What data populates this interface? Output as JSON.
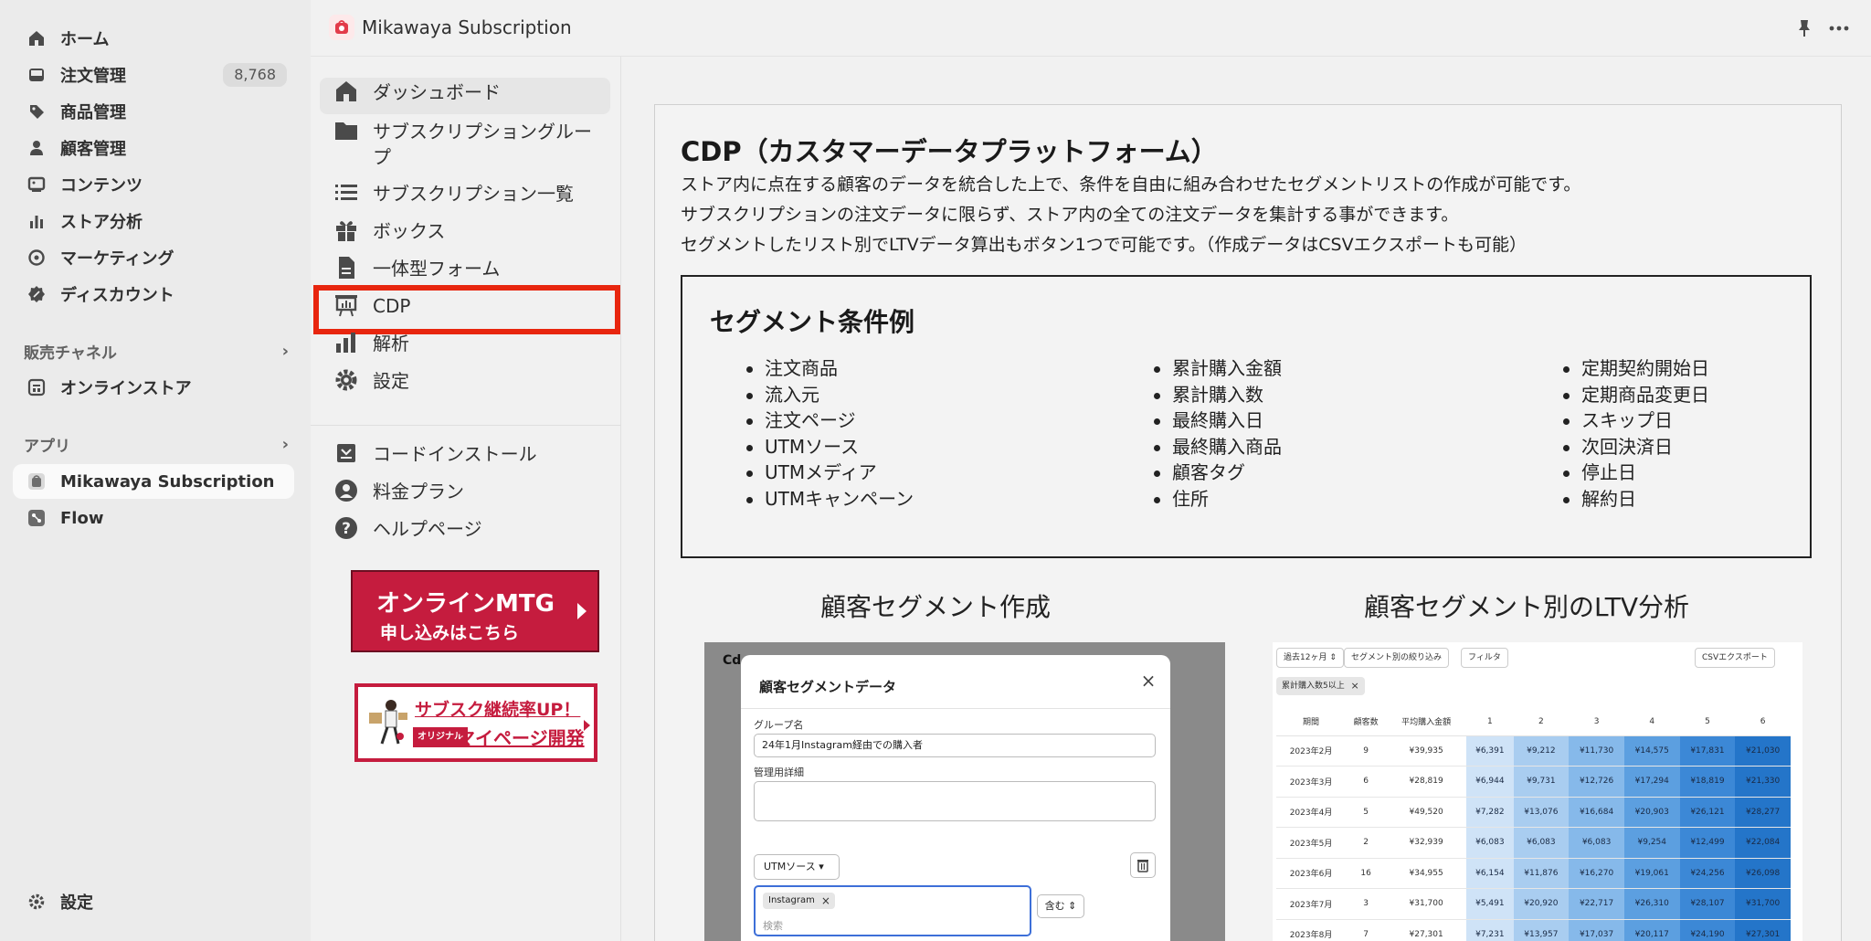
{
  "sidebar": {
    "items": [
      {
        "label": "ホーム",
        "icon": "home-icon"
      },
      {
        "label": "注文管理",
        "icon": "inbox-icon",
        "badge": "8,768"
      },
      {
        "label": "商品管理",
        "icon": "tag-icon"
      },
      {
        "label": "顧客管理",
        "icon": "person-icon"
      },
      {
        "label": "コンテンツ",
        "icon": "content-icon"
      },
      {
        "label": "ストア分析",
        "icon": "bar-chart-icon"
      },
      {
        "label": "マーケティング",
        "icon": "target-icon"
      },
      {
        "label": "ディスカウント",
        "icon": "discount-icon"
      }
    ],
    "sales_channel_header": "販売チャネル",
    "online_store": "オンラインストア",
    "apps_header": "アプリ",
    "app_mikawaya": "Mikawaya Subscription",
    "app_flow": "Flow",
    "settings": "設定"
  },
  "topbar": {
    "title": "Mikawaya Subscription"
  },
  "appnav": {
    "items": [
      {
        "label": "ダッシュボード"
      },
      {
        "label": "サブスクリプショングループ"
      },
      {
        "label": "サブスクリプション一覧"
      },
      {
        "label": "ボックス"
      },
      {
        "label": "一体型フォーム"
      },
      {
        "label": "CDP"
      },
      {
        "label": "解析"
      },
      {
        "label": "設定"
      }
    ],
    "secondary": [
      {
        "label": "コードインストール"
      },
      {
        "label": "料金プラン"
      },
      {
        "label": "ヘルプページ"
      }
    ],
    "mtg_banner": {
      "line1": "オンラインMTG",
      "line2": "申し込みはこちら"
    },
    "mypage_banner": {
      "line1": "サブスク継続率UP！",
      "tag": "オリジナル",
      "line2": "マイページ開発"
    }
  },
  "main": {
    "title": "CDP（カスタマーデータプラットフォーム）",
    "descriptions": [
      "ストア内に点在する顧客のデータを統合した上で、条件を自由に組み合わせたセグメントリストの作成が可能です。",
      "サブスクリプションの注文データに限らず、ストア内の全ての注文データを集計する事ができます。",
      "セグメントしたリスト別でLTVデータ算出もボタン1つで可能です。（作成データはCSVエクスポートも可能）"
    ],
    "segment_box": {
      "title": "セグメント条件例",
      "col1": [
        "注文商品",
        "流入元",
        "注文ページ",
        "UTMソース",
        "UTMメディア",
        "UTMキャンペーン"
      ],
      "col2": [
        "累計購入金額",
        "累計購入数",
        "最終購入日",
        "最終購入商品",
        "顧客タグ",
        "住所"
      ],
      "col3": [
        "定期契約開始日",
        "定期商品変更日",
        "スキップ日",
        "次回決済日",
        "停止日",
        "解約日"
      ]
    },
    "left_heading": "顧客セグメント作成",
    "right_heading": "顧客セグメント別のLTV分析",
    "segment_modal": {
      "bg_text": "Cd",
      "title": "顧客セグメントデータ",
      "group_label": "グループ名",
      "group_value": "24年1月Instagram経由での購入者",
      "detail_label": "管理用詳細",
      "select_value": "UTMソース",
      "tag": "Instagram",
      "search_placeholder": "検索",
      "contains": "含む"
    },
    "ltv": {
      "btn_period": "過去12ヶ月",
      "btn_segment": "セグメント別の絞り込み",
      "btn_filter": "フィルタ",
      "btn_csv": "CSVエクスポート",
      "chip": "累計購入数5以上",
      "headers": [
        "期間",
        "顧客数",
        "平均購入金額",
        "1",
        "2",
        "3",
        "4",
        "5",
        "6"
      ],
      "rows": [
        [
          "2023年2月",
          "9",
          "¥39,935",
          "¥6,391",
          "¥9,212",
          "¥11,730",
          "¥14,575",
          "¥17,831",
          "¥21,030"
        ],
        [
          "2023年3月",
          "6",
          "¥28,819",
          "¥6,944",
          "¥9,731",
          "¥12,726",
          "¥17,294",
          "¥18,819",
          "¥21,330"
        ],
        [
          "2023年4月",
          "5",
          "¥49,520",
          "¥7,282",
          "¥13,076",
          "¥16,684",
          "¥20,903",
          "¥26,121",
          "¥28,277"
        ],
        [
          "2023年5月",
          "2",
          "¥32,939",
          "¥6,083",
          "¥6,083",
          "¥6,083",
          "¥9,254",
          "¥12,499",
          "¥22,084"
        ],
        [
          "2023年6月",
          "16",
          "¥34,955",
          "¥6,154",
          "¥11,876",
          "¥16,270",
          "¥19,061",
          "¥24,256",
          "¥26,098"
        ],
        [
          "2023年7月",
          "3",
          "¥31,700",
          "¥5,491",
          "¥20,920",
          "¥22,717",
          "¥26,310",
          "¥28,107",
          "¥31,700"
        ],
        [
          "2023年8月",
          "7",
          "¥27,301",
          "¥7,231",
          "¥13,957",
          "¥17,037",
          "¥20,117",
          "¥24,190",
          "¥27,301"
        ]
      ],
      "heat_colors": [
        "#cfe3f7",
        "#a9cdf0",
        "#86b9ea",
        "#5c9fe0",
        "#3c88d6",
        "#2475c9"
      ]
    }
  },
  "colors": {
    "highlight": "#e8260f",
    "brand_red": "#c51c3e"
  }
}
